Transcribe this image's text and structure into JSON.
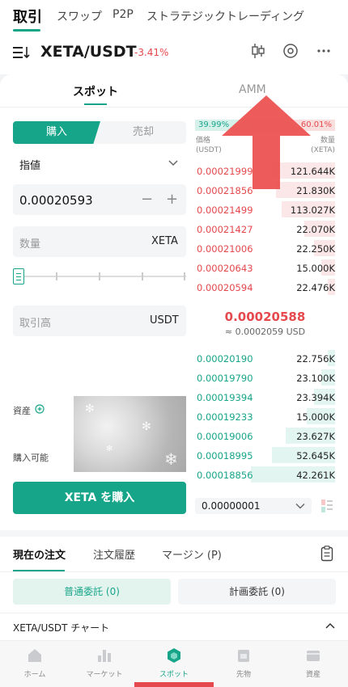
{
  "top_nav": {
    "tabs": [
      "取引",
      "スワップ",
      "P2P",
      "ストラテジックトレーディング"
    ]
  },
  "pair_bar": {
    "pair": "XETA/USDT",
    "change": "-3.41%"
  },
  "main_tabs": [
    "スポット",
    "AMM"
  ],
  "order_form": {
    "side_buy": "購入",
    "side_sell": "売却",
    "order_type": "指値",
    "price_value": "0.00020593",
    "minus": "−",
    "plus": "+",
    "amount_placeholder": "数量",
    "amount_unit": "XETA",
    "total_placeholder": "取引高",
    "total_unit": "USDT",
    "assets_label": "資産",
    "buyable_label": "購入可能",
    "buy_button": "XETA を購入"
  },
  "orderbook": {
    "buy_pct": "39.99%",
    "sell_pct": "60.01%",
    "price_header": "価格",
    "price_unit": "(USDT)",
    "qty_header": "数量",
    "qty_unit": "(XETA)",
    "asks": [
      {
        "price": "0.00021999",
        "qty": "121.644K",
        "depth": 0.45
      },
      {
        "price": "0.00021856",
        "qty": "21.830K",
        "depth": 0.42
      },
      {
        "price": "0.00021499",
        "qty": "113.027K",
        "depth": 0.38
      },
      {
        "price": "0.00021427",
        "qty": "22.070K",
        "depth": 0.22
      },
      {
        "price": "0.00021006",
        "qty": "22.250K",
        "depth": 0.15
      },
      {
        "price": "0.00020643",
        "qty": "15.000K",
        "depth": 0.1
      },
      {
        "price": "0.00020594",
        "qty": "22.476K",
        "depth": 0.05
      }
    ],
    "mid_price": "0.00020588",
    "mid_price_usd": "≈ 0.0002059 USD",
    "bids": [
      {
        "price": "0.00020190",
        "qty": "22.756K",
        "depth": 0.05
      },
      {
        "price": "0.00019790",
        "qty": "23.100K",
        "depth": 0.1
      },
      {
        "price": "0.00019394",
        "qty": "23.394K",
        "depth": 0.15
      },
      {
        "price": "0.00019233",
        "qty": "15.000K",
        "depth": 0.2
      },
      {
        "price": "0.00019006",
        "qty": "23.627K",
        "depth": 0.35
      },
      {
        "price": "0.00018995",
        "qty": "52.645K",
        "depth": 0.45
      },
      {
        "price": "0.00018856",
        "qty": "42.261K",
        "depth": 0.6
      }
    ],
    "precision": "0.00000001"
  },
  "orders": {
    "tabs": [
      "現在の注文",
      "注文履歴",
      "マージン (P)"
    ],
    "normal_orders": "普通委託 (0)",
    "plan_orders": "計画委託 (0)",
    "chart_link": "XETA/USDT チャート"
  },
  "tabbar": {
    "items": [
      "ホーム",
      "マーケット",
      "スポット",
      "先物",
      "資産"
    ]
  },
  "colors": {
    "accent": "#17a589",
    "down": "#e5484d"
  }
}
